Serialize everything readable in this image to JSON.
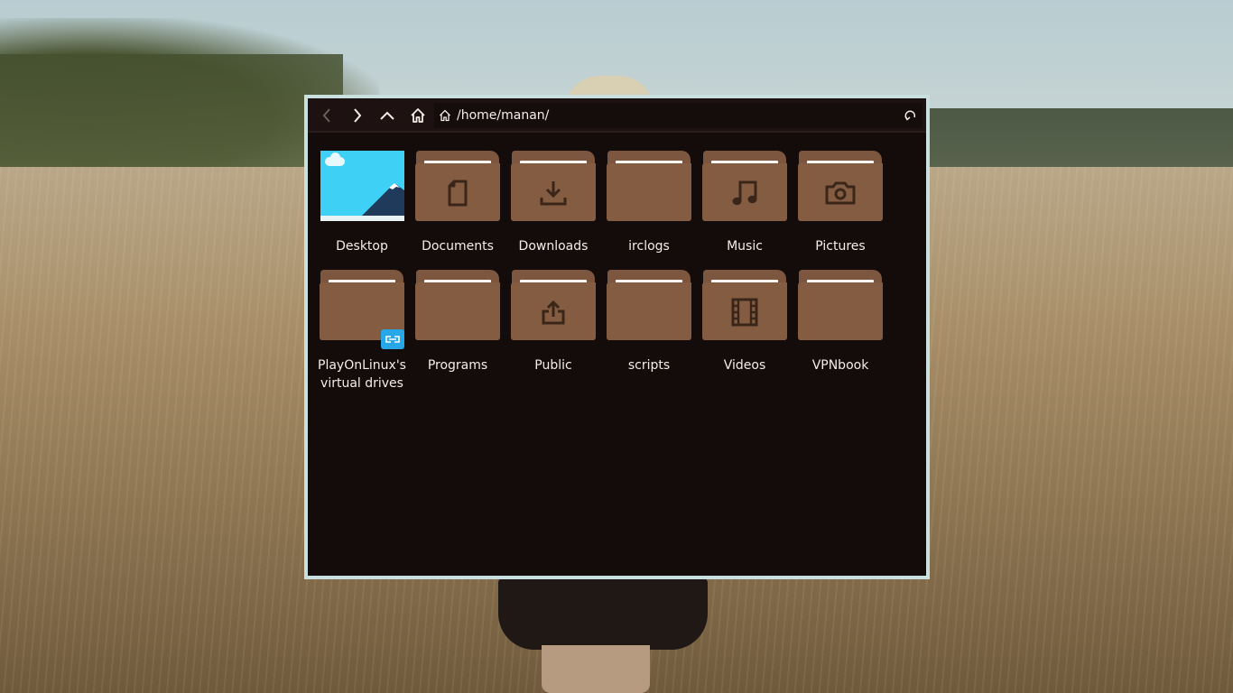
{
  "window": {
    "path": "/home/manan/"
  },
  "toolbar": {
    "back_icon": "chevron-left-icon",
    "forward_icon": "chevron-right-icon",
    "up_icon": "chevron-up-icon",
    "home_icon": "home-icon",
    "reload_icon": "reload-icon"
  },
  "items": [
    {
      "label": "Desktop",
      "icon": "desktop-thumbnail"
    },
    {
      "label": "Documents",
      "icon": "document-icon"
    },
    {
      "label": "Downloads",
      "icon": "download-icon"
    },
    {
      "label": "irclogs",
      "icon": "folder-icon"
    },
    {
      "label": "Music",
      "icon": "music-note-icon"
    },
    {
      "label": "Pictures",
      "icon": "camera-icon"
    },
    {
      "label": "PlayOnLinux's virtual drives",
      "icon": "folder-icon",
      "badge": "link-icon"
    },
    {
      "label": "Programs",
      "icon": "folder-icon"
    },
    {
      "label": "Public",
      "icon": "share-upload-icon"
    },
    {
      "label": "scripts",
      "icon": "folder-icon"
    },
    {
      "label": "Videos",
      "icon": "film-icon"
    },
    {
      "label": "VPNbook",
      "icon": "folder-icon"
    }
  ],
  "colors": {
    "window_bg": "#140c0b",
    "window_border": "#c9dfe0",
    "folder": "#845c42",
    "desktop_thumb": "#3fd0f6",
    "badge": "#27a6e8"
  }
}
